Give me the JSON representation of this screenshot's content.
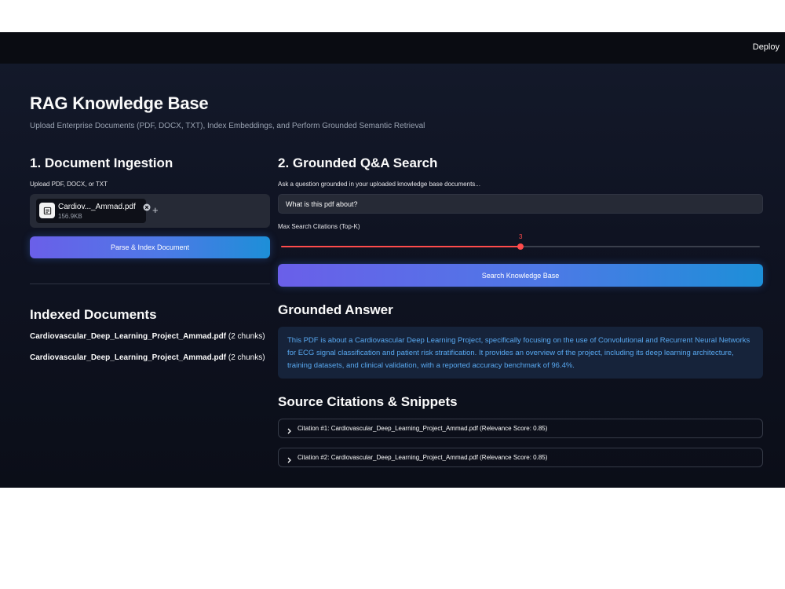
{
  "topbar": {
    "deploy_label": "Deploy"
  },
  "header": {
    "title": "RAG Knowledge Base",
    "subtitle": "Upload Enterprise Documents (PDF, DOCX, TXT), Index Embeddings, and Perform Grounded Semantic Retrieval"
  },
  "ingestion": {
    "heading": "1. Document Ingestion",
    "upload_label": "Upload PDF, DOCX, or TXT",
    "file": {
      "name": "Cardiov..._Ammad.pdf",
      "size": "156.9KB",
      "icon": "file-document-icon"
    },
    "add_icon": "+",
    "parse_button": "Parse & Index Document"
  },
  "indexed": {
    "heading": "Indexed Documents",
    "items": [
      {
        "name": "Cardiovascular_Deep_Learning_Project_Ammad.pdf",
        "chunks": " (2 chunks)"
      },
      {
        "name": "Cardiovascular_Deep_Learning_Project_Ammad.pdf",
        "chunks": " (2 chunks)"
      }
    ]
  },
  "search": {
    "heading": "2. Grounded Q&A Search",
    "question_label": "Ask a question grounded in your uploaded knowledge base documents...",
    "question_value": "What is this pdf about?",
    "slider_label": "Max Search Citations (Top-K)",
    "slider": {
      "value": 3,
      "value_text": "3",
      "min": 1,
      "max": 5,
      "fraction": 0.5
    },
    "search_button": "Search Knowledge Base"
  },
  "answer": {
    "heading": "Grounded Answer",
    "text": "This PDF is about a Cardiovascular Deep Learning Project, specifically focusing on the use of Convolutional and Recurrent Neural Networks for ECG signal classification and patient risk stratification. It provides an overview of the project, including its deep learning architecture, training datasets, and clinical validation, with a reported accuracy benchmark of 96.4%."
  },
  "citations": {
    "heading": "Source Citations & Snippets",
    "items": [
      {
        "label": "Citation #1: Cardiovascular_Deep_Learning_Project_Ammad.pdf (Relevance Score: 0.85)"
      },
      {
        "label": "Citation #2: Cardiovascular_Deep_Learning_Project_Ammad.pdf (Relevance Score: 0.85)"
      }
    ]
  },
  "colors": {
    "accent_red": "#ff4b4b",
    "answer_text": "#58a8f0",
    "button_gradient_start": "#6a5fe9",
    "button_gradient_end": "#1d8fd8"
  }
}
